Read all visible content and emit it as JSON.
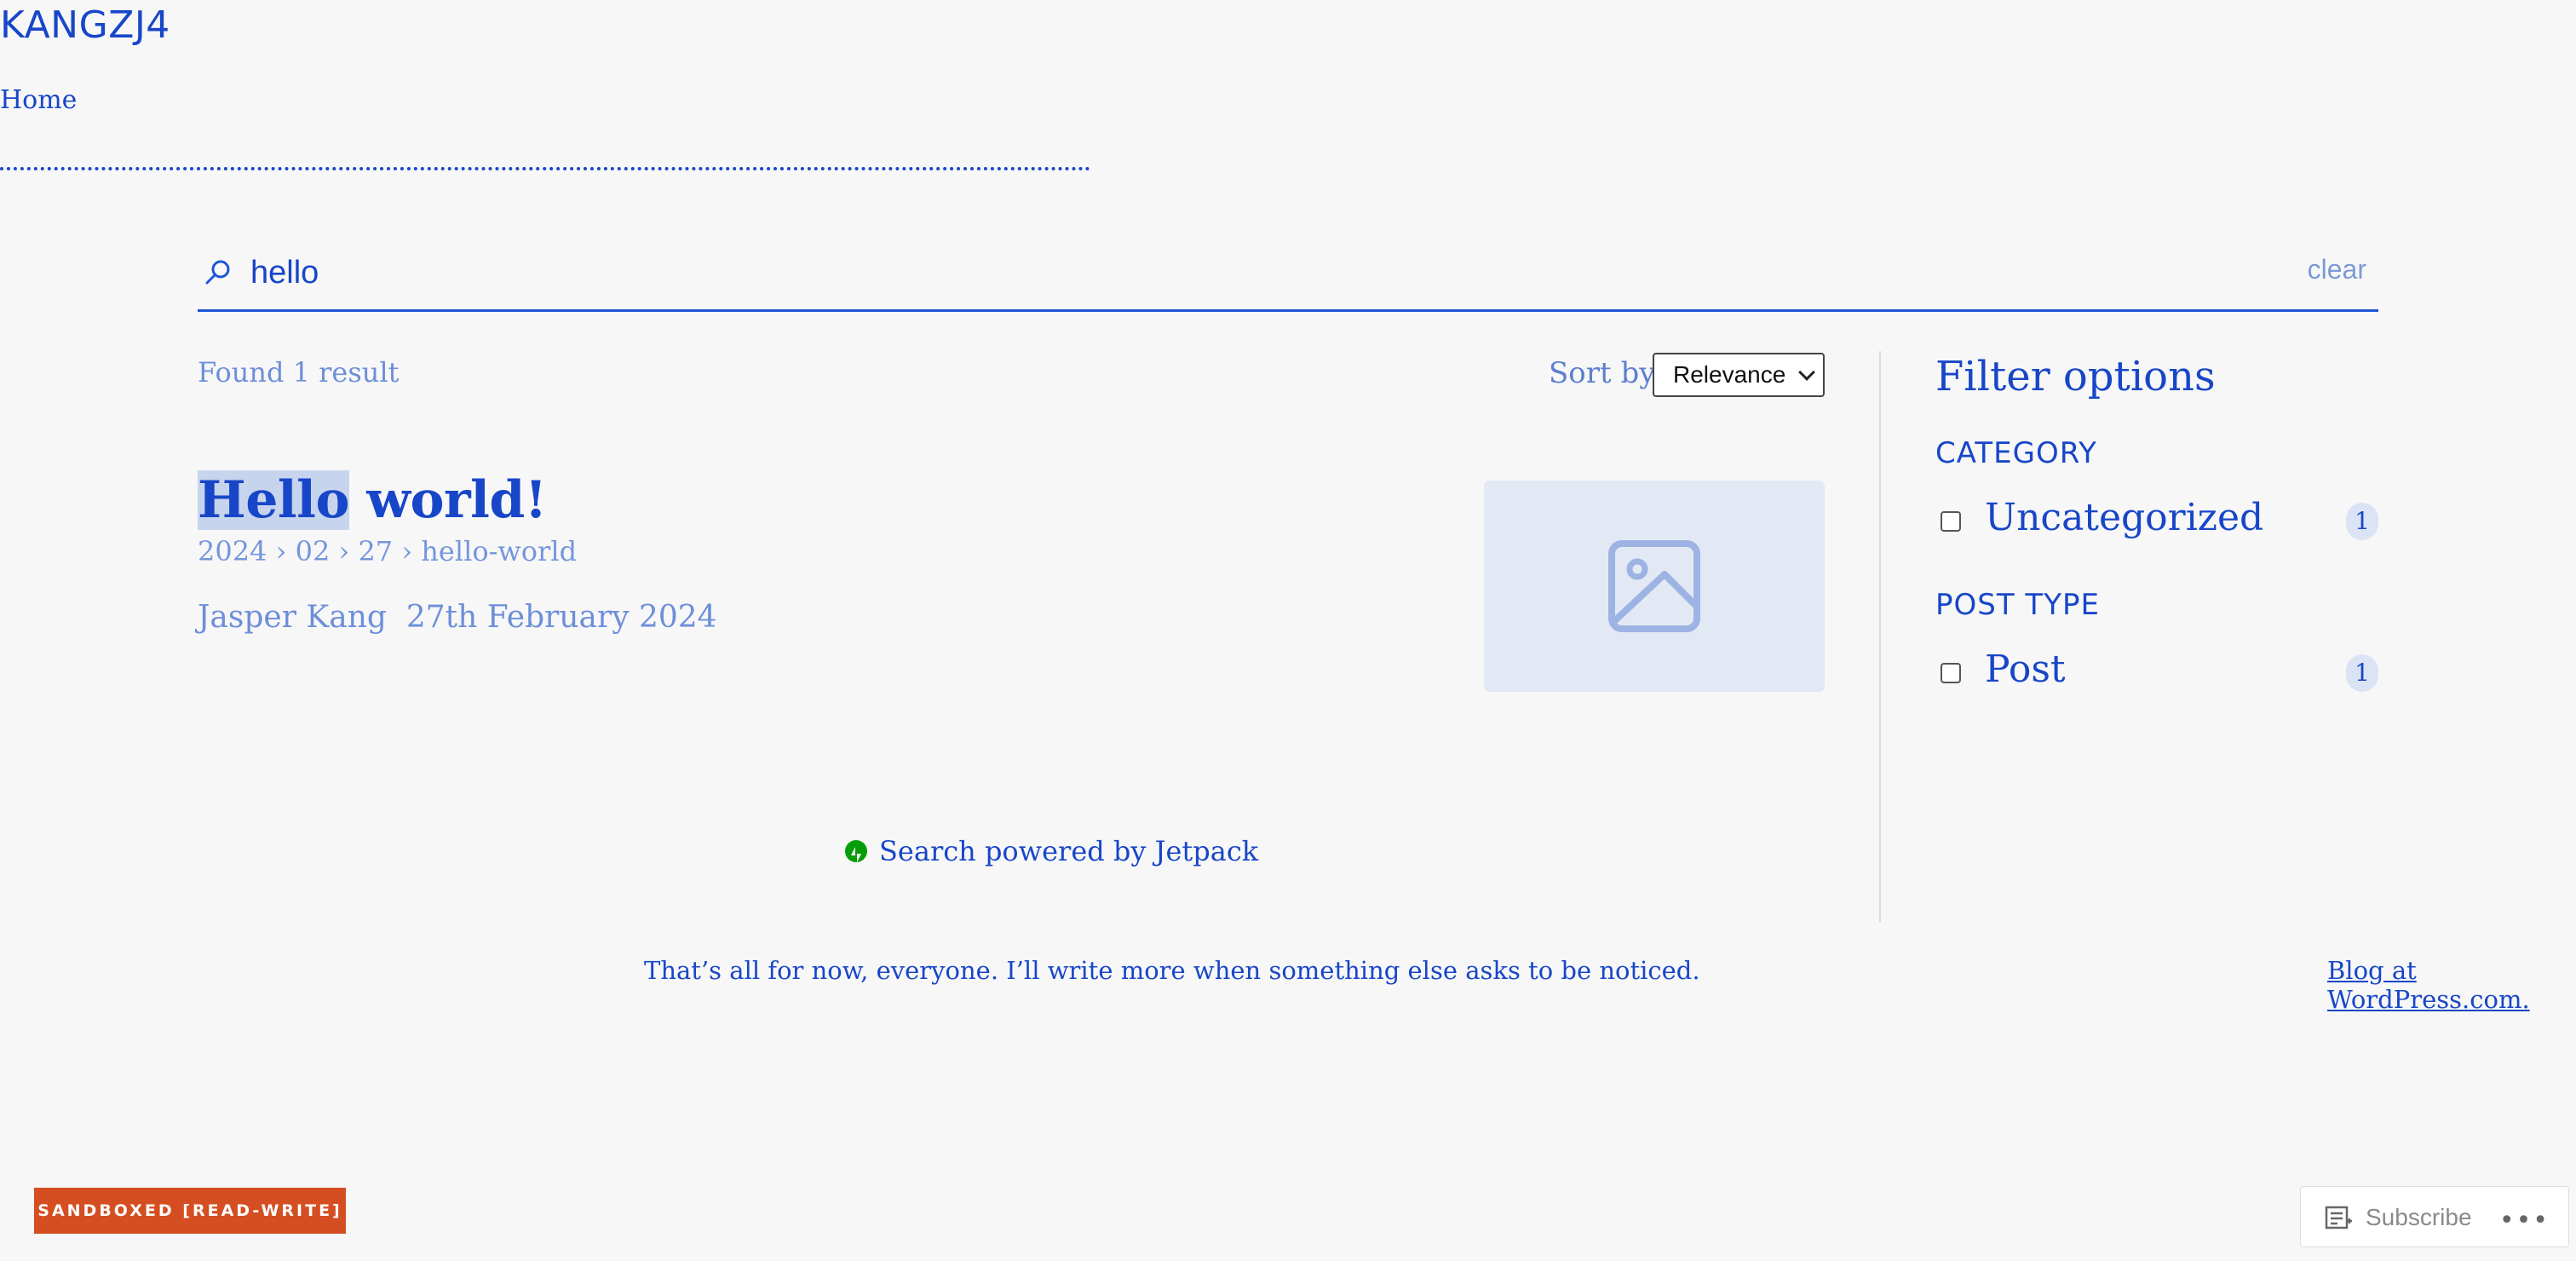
{
  "site": {
    "title": "KANGZJ4",
    "nav": {
      "home": "Home"
    }
  },
  "search": {
    "query": "hello",
    "clear_label": "clear"
  },
  "results": {
    "found_text": "Found 1 result",
    "sort_label": "Sort by",
    "sort_selected": "Relevance",
    "items": [
      {
        "title_highlight": "Hello",
        "title_rest": " world!",
        "path": "2024 › 02 › 27 › hello-world",
        "author": "Jasper Kang",
        "date": "27th February 2024"
      }
    ],
    "powered_by": "Search powered by Jetpack"
  },
  "filters": {
    "title": "Filter options",
    "groups": [
      {
        "heading": "CATEGORY",
        "options": [
          {
            "label": "Uncategorized",
            "count": "1"
          }
        ]
      },
      {
        "heading": "POST TYPE",
        "options": [
          {
            "label": "Post",
            "count": "1"
          }
        ]
      }
    ]
  },
  "footer": {
    "text": "That’s all for now, everyone. I’ll write more when something else asks to be noticed.",
    "link": "Blog at WordPress.com."
  },
  "sandbox_label": "SANDBOXED [READ-WRITE]",
  "actionbar": {
    "subscribe": "Subscribe",
    "more": "•••"
  },
  "colors": {
    "accent": "#1846c8",
    "sandbox": "#d54e21",
    "jetpack": "#069e08"
  }
}
